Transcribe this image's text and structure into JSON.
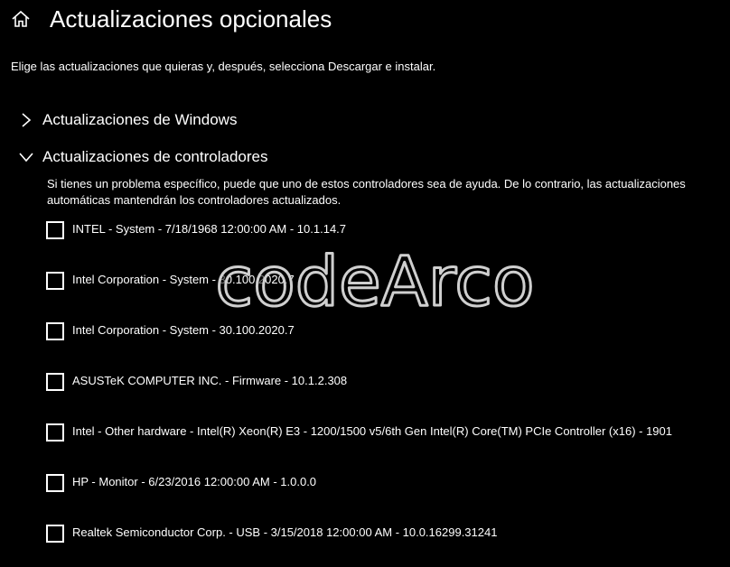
{
  "header": {
    "home_icon": "home-icon",
    "title": "Actualizaciones opcionales"
  },
  "subtitle": "Elige las actualizaciones que quieras y, después, selecciona Descargar e instalar.",
  "sections": {
    "windows": {
      "label": "Actualizaciones de Windows",
      "expanded": false,
      "icon": "chevron-right-icon"
    },
    "drivers": {
      "label": "Actualizaciones de controladores",
      "expanded": true,
      "icon": "chevron-down-icon",
      "description_line1": "Si tienes un problema específico, puede que uno de estos controladores sea de ayuda. De lo contrario, las actualizaciones",
      "description_line2": "automáticas mantendrán los controladores actualizados.",
      "items": [
        {
          "label": "INTEL - System - 7/18/1968 12:00:00 AM - 10.1.14.7",
          "checked": false
        },
        {
          "label": "Intel Corporation - System - 30.100.2020.7",
          "checked": false
        },
        {
          "label": "Intel Corporation - System - 30.100.2020.7",
          "checked": false
        },
        {
          "label": "ASUSTeK COMPUTER INC. - Firmware - 10.1.2.308",
          "checked": false
        },
        {
          "label": "Intel - Other hardware - Intel(R) Xeon(R) E3 - 1200/1500 v5/6th Gen Intel(R) Core(TM) PCIe Controller (x16) - 1901",
          "checked": false
        },
        {
          "label": "HP - Monitor - 6/23/2016 12:00:00 AM - 1.0.0.0",
          "checked": false
        },
        {
          "label": "Realtek Semiconductor Corp. - USB - 3/15/2018 12:00:00 AM - 10.0.16299.31241",
          "checked": false
        }
      ]
    }
  },
  "watermark": {
    "text": "codeArco"
  },
  "colors": {
    "background": "#000000",
    "text": "#ffffff",
    "watermark_fill": "#000000",
    "watermark_stroke": "#cfcfcf"
  }
}
